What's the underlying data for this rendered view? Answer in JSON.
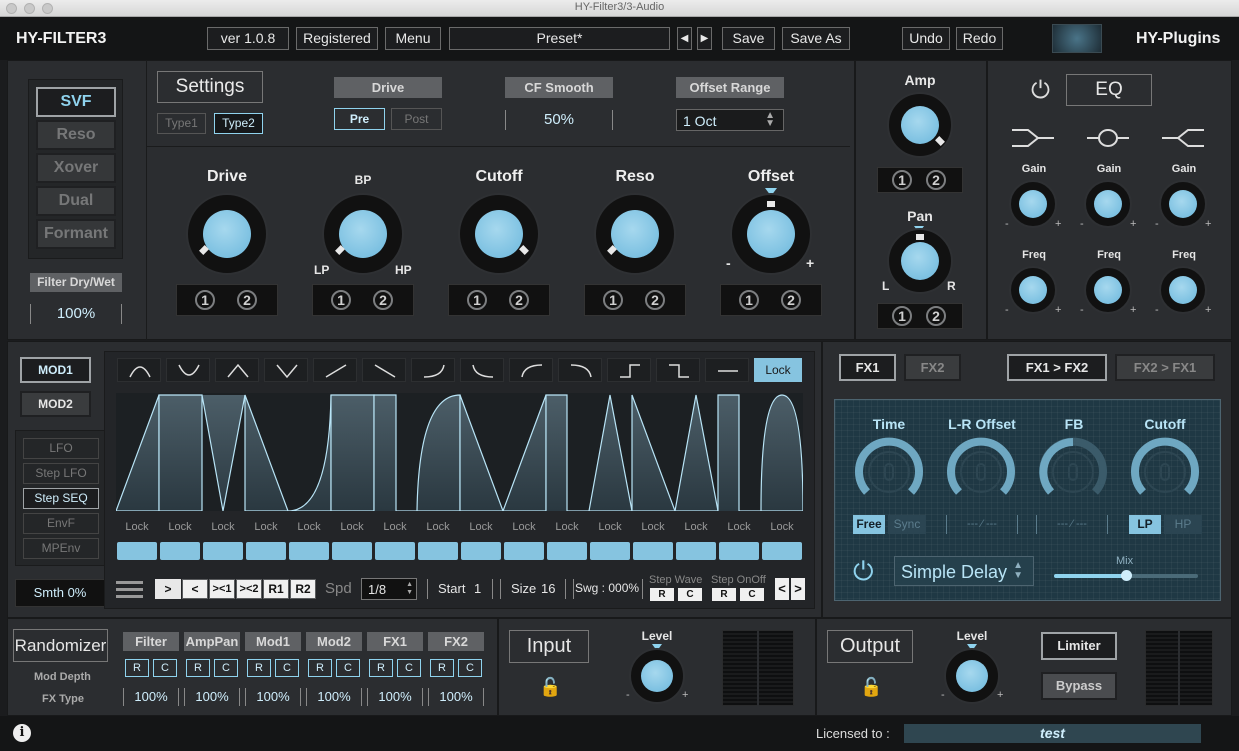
{
  "window": {
    "title": "HY-Filter3/3-Audio"
  },
  "header": {
    "brand": "HY-FILTER3",
    "version": "ver 1.0.8",
    "registered": "Registered",
    "menu": "Menu",
    "preset": "Preset*",
    "save": "Save",
    "save_as": "Save As",
    "undo": "Undo",
    "redo": "Redo",
    "vendor": "HY-Plugins"
  },
  "filter_types": [
    "SVF",
    "Reso",
    "Xover",
    "Dual",
    "Formant"
  ],
  "filter_dry_wet": {
    "label": "Filter Dry/Wet",
    "value": "100%"
  },
  "settings": {
    "label": "Settings",
    "type1": "Type1",
    "type2": "Type2",
    "drive": "Drive",
    "pre": "Pre",
    "post": "Post",
    "cf_smooth": "CF Smooth",
    "cf_value": "50%",
    "offset_range": "Offset Range",
    "offset_value": "1 Oct"
  },
  "knobs": {
    "drive": "Drive",
    "bp": "BP",
    "lp": "LP",
    "hp": "HP",
    "cutoff": "Cutoff",
    "reso": "Reso",
    "offset": "Offset",
    "minus": "-",
    "plus": "+",
    "amp": "Amp",
    "pan": "Pan",
    "l": "L",
    "r": "R"
  },
  "mod_slots": [
    "1",
    "2"
  ],
  "eq": {
    "label": "EQ",
    "gain": "Gain",
    "freq": "Freq",
    "minus": "-",
    "plus": "+"
  },
  "mod": {
    "mod1": "MOD1",
    "mod2": "MOD2",
    "types": [
      "LFO",
      "Step LFO",
      "Step SEQ",
      "EnvF",
      "MPEnv"
    ],
    "smooth": "Smth 0%",
    "lock": "Lock",
    "step_lock": "Lock",
    "steps": [
      1,
      1,
      0.65,
      1,
      1,
      1,
      1,
      1,
      1,
      1,
      1,
      1,
      1,
      1,
      1,
      1
    ]
  },
  "seq": {
    "fwd": ">",
    "rev": "<",
    "pp1": "><1",
    "pp2": "><2",
    "r1": "R1",
    "r2": "R2",
    "spd": "Spd",
    "spd_value": "1/8",
    "start_label": "Start",
    "start": "1",
    "size_label": "Size",
    "size": "16",
    "swing": "Swg : 000%",
    "step_wave": "Step Wave",
    "step_onoff": "Step OnOff",
    "r": "R",
    "c": "C",
    "prev": "<",
    "next": ">"
  },
  "fx": {
    "fx1": "FX1",
    "fx2": "FX2",
    "fx1_to_fx2": "FX1 > FX2",
    "fx2_to_fx1": "FX2 > FX1",
    "time": "Time",
    "lr_offset": "L-R Offset",
    "fb": "FB",
    "cutoff": "Cutoff",
    "free": "Free",
    "sync": "Sync",
    "dash": "--- ⁄ ---",
    "lp": "LP",
    "hp": "HP",
    "effect": "Simple Delay",
    "mix": "Mix"
  },
  "randomizer": {
    "label": "Randomizer",
    "mod_depth": "Mod Depth",
    "fx_type": "FX Type",
    "targets": [
      "Filter",
      "AmpPan",
      "Mod1",
      "Mod2",
      "FX1",
      "FX2"
    ],
    "r": "R",
    "c": "C",
    "value": "100%"
  },
  "io": {
    "input": "Input",
    "output": "Output",
    "level": "Level",
    "minus": "-",
    "plus": "+",
    "limiter": "Limiter",
    "bypass": "Bypass"
  },
  "footer": {
    "licensed_to": "Licensed to :",
    "user": "test"
  },
  "colors": {
    "accent": "#8fd3ee",
    "knob": "#6bb7dc",
    "panel": "#2b2d30"
  }
}
